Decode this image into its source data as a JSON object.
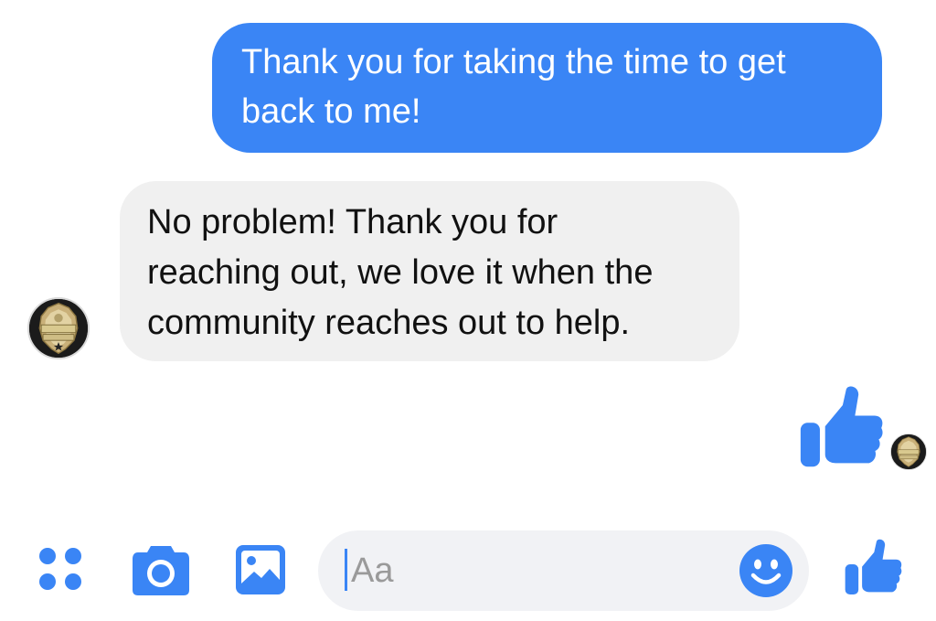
{
  "conversation": {
    "messages": [
      {
        "sender": "me",
        "lines": [
          "Thank you for taking the time to get",
          "back to me!"
        ]
      },
      {
        "sender": "them",
        "lines": [
          "No problem! Thank you for",
          "reaching out, we love it when the",
          "community reaches out to help."
        ]
      }
    ],
    "sent_reaction_icon": "thumbs-up-icon",
    "contact_avatar": "police-badge-avatar"
  },
  "composer": {
    "placeholder": "Aa",
    "value": ""
  },
  "toolbar": {
    "icons": [
      "apps-grid-icon",
      "camera-icon",
      "image-icon",
      "emoji-icon",
      "thumbs-up-icon"
    ]
  },
  "colors": {
    "accent": "#3a85f5",
    "incoming_bubble": "#f0f0f0",
    "composer_bg": "#f1f2f5"
  }
}
